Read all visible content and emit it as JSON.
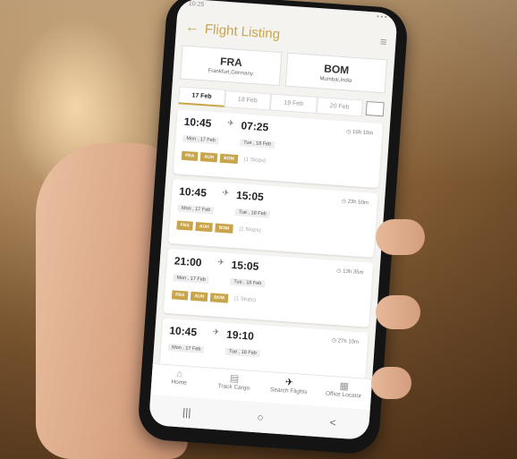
{
  "status": {
    "left": "10:25",
    "right": "• • •"
  },
  "appbar": {
    "back_icon": "←",
    "title": "Flight Listing",
    "menu_icon": "≡"
  },
  "route": {
    "from": {
      "code": "FRA",
      "name": "Frankfurt,Germany"
    },
    "to": {
      "code": "BOM",
      "name": "Mumbai,India"
    }
  },
  "dates": [
    "17 Feb",
    "18 Feb",
    "19 Feb",
    "20 Feb"
  ],
  "flights": [
    {
      "dep_time": "10:45",
      "dep_date": "Mon , 17 Feb",
      "arr_time": "07:25",
      "arr_date": "Tue , 18 Feb",
      "duration": "16h 10m",
      "tags": [
        "FRA",
        "AUH",
        "BOM"
      ],
      "stops": "(1 Stops)"
    },
    {
      "dep_time": "10:45",
      "dep_date": "Mon , 17 Feb",
      "arr_time": "15:05",
      "arr_date": "Tue , 18 Feb",
      "duration": "23h 50m",
      "tags": [
        "FRA",
        "AUH",
        "BOM"
      ],
      "stops": "(1 Stops)"
    },
    {
      "dep_time": "21:00",
      "dep_date": "Mon , 17 Feb",
      "arr_time": "15:05",
      "arr_date": "Tue , 18 Feb",
      "duration": "13h 35m",
      "tags": [
        "FRA",
        "AUH",
        "BOM"
      ],
      "stops": "(1 Stops)"
    },
    {
      "dep_time": "10:45",
      "dep_date": "Mon , 17 Feb",
      "arr_time": "19:10",
      "arr_date": "Tue , 18 Feb",
      "duration": "27h 10m",
      "tags": [],
      "stops": ""
    }
  ],
  "nav": [
    {
      "label": "Home",
      "icon": "⌂"
    },
    {
      "label": "Track Cargo",
      "icon": "▤"
    },
    {
      "label": "Search Flights",
      "icon": "✈"
    },
    {
      "label": "Office Locator",
      "icon": "▦"
    }
  ],
  "sysnav": {
    "recent": "|||",
    "home": "○",
    "back": "<"
  }
}
